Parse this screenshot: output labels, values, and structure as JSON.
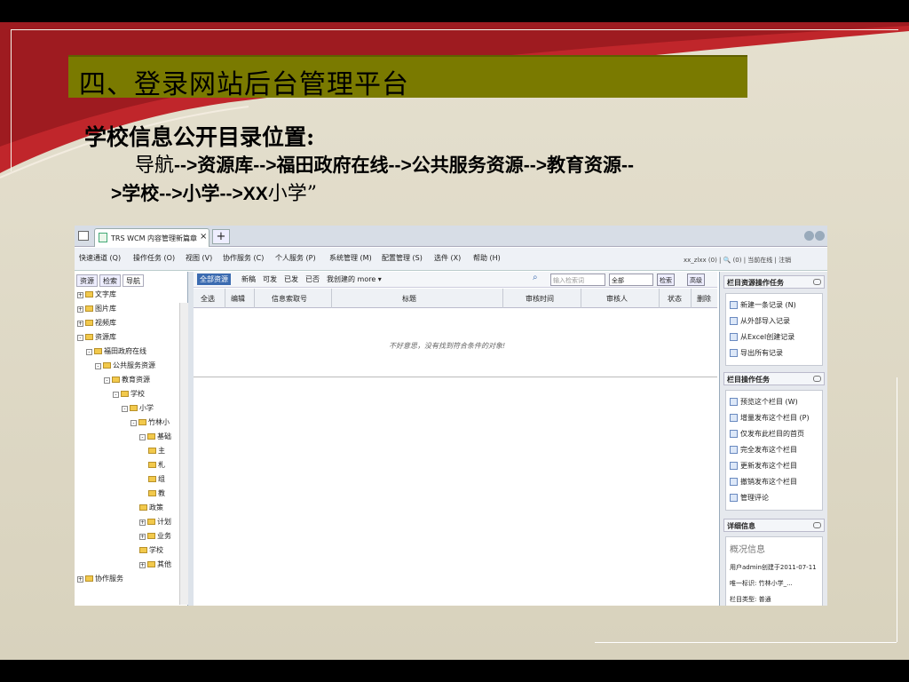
{
  "slide": {
    "title": "四、登录网站后台管理平台",
    "subtitle": "学校信息公开目录位置:",
    "path_line1_prefix": "导航",
    "path_line1_rest": "-->资源库-->福田政府在线-->公共服务资源-->教育资源--",
    "path_line2": ">学校-->小学-->",
    "path_line2_xx": "XX",
    "path_line2_end": "小学”"
  },
  "browser": {
    "tab_title": "TRS WCM 内容管理新篇章",
    "tab_close": "×",
    "new_tab": "+"
  },
  "menubar": {
    "items": [
      "快速通道 (Q)",
      "操作任务 (O)",
      "视图 (V)",
      "协作服务 (C)",
      "个人服务 (P)",
      "系统管理 (M)",
      "配置管理 (S)",
      "选件 (X)",
      "帮助 (H)"
    ],
    "user_info": "xx_zlxx (0) | 🔍 (0) | 当前在线 | 注销"
  },
  "left_panel": {
    "tabs": [
      "资源",
      "检索",
      "导航"
    ],
    "tree": [
      {
        "label": "文字库",
        "depth": 0,
        "pm": "+"
      },
      {
        "label": "图片库",
        "depth": 0,
        "pm": "+"
      },
      {
        "label": "视频库",
        "depth": 0,
        "pm": "+"
      },
      {
        "label": "资源库",
        "depth": 0,
        "pm": "-"
      },
      {
        "label": "福田政府在线",
        "depth": 1,
        "pm": "-"
      },
      {
        "label": "公共服务资源",
        "depth": 2,
        "pm": "-"
      },
      {
        "label": "教育资源",
        "depth": 3,
        "pm": "-"
      },
      {
        "label": "学校",
        "depth": 4,
        "pm": "-"
      },
      {
        "label": "小学",
        "depth": 5,
        "pm": "-"
      },
      {
        "label": "竹林小",
        "depth": 6,
        "pm": "-"
      },
      {
        "label": "基础",
        "depth": 7,
        "pm": "-"
      },
      {
        "label": "主",
        "depth": 8,
        "pm": ""
      },
      {
        "label": "札",
        "depth": 8,
        "pm": ""
      },
      {
        "label": "组",
        "depth": 8,
        "pm": ""
      },
      {
        "label": "教",
        "depth": 8,
        "pm": ""
      },
      {
        "label": "政策",
        "depth": 7,
        "pm": ""
      },
      {
        "label": "计划",
        "depth": 7,
        "pm": "+"
      },
      {
        "label": "业务",
        "depth": 7,
        "pm": "+"
      },
      {
        "label": "学校",
        "depth": 7,
        "pm": ""
      },
      {
        "label": "其他",
        "depth": 7,
        "pm": "+"
      },
      {
        "label": "协作服务",
        "depth": 0,
        "pm": "+"
      }
    ]
  },
  "main": {
    "toolbar": [
      "全部资源",
      "新稿",
      "可发",
      "已发",
      "已否",
      "我创建的 more ▾"
    ],
    "search_placeholder": "输入检索词",
    "scope_select": "全部",
    "search_button": "检索",
    "advanced_button": "高级",
    "columns": [
      "全选",
      "编辑",
      "信息索取号",
      "标题",
      "审核时间",
      "审核人",
      "状态",
      "删除"
    ],
    "empty_message": "不好意思，没有找到符合条件的对象!"
  },
  "right_panel": {
    "resource_tasks_title": "栏目资源操作任务",
    "resource_tasks": [
      "新建一条记录 (N)",
      "从外部导入记录",
      "从Excel创建记录",
      "导出所有记录"
    ],
    "column_tasks_title": "栏目操作任务",
    "column_tasks": [
      "预览这个栏目 (W)",
      "增量发布这个栏目 (P)",
      "仅发布此栏目的首页",
      "完全发布这个栏目",
      "更新发布这个栏目",
      "撤销发布这个栏目",
      "管理评论"
    ],
    "detail_title": "详细信息",
    "overview_title": "概况信息",
    "overview_lines": [
      "用户admin创建于2011-07-11",
      "唯一标识: 竹林小学_...",
      "栏目类型: 普通"
    ]
  }
}
